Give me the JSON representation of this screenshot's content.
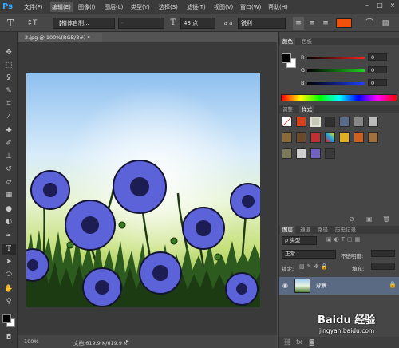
{
  "app": {
    "logo": "Ps"
  },
  "menu": {
    "items": [
      "文件(F)",
      "编辑(E)",
      "图像(I)",
      "图层(L)",
      "类型(Y)",
      "选择(S)",
      "滤镜(T)",
      "视图(V)",
      "窗口(W)",
      "帮助(H)"
    ],
    "window_buttons": [
      "–",
      "□",
      "×"
    ]
  },
  "options": {
    "font_family": "【楷体自制...",
    "font_style": "-",
    "font_size": "48 点",
    "aa_label": "a a",
    "aa_value": "锐利",
    "color": "#f0520c"
  },
  "document": {
    "tab_title": "2.jpg @ 100%(RGB/8#) *",
    "zoom": "100%",
    "status_text": "文档:619.9 K/619.9 K"
  },
  "color_panel": {
    "tabs": [
      "颜色",
      "色板"
    ],
    "channels": [
      {
        "label": "R",
        "value": "0",
        "track": "#ff3030"
      },
      {
        "label": "G",
        "value": "0",
        "track": "#30c030"
      },
      {
        "label": "B",
        "value": "0",
        "track": "#3050ff"
      }
    ],
    "foreground": "#000000",
    "background": "#ffffff"
  },
  "styles_panel": {
    "tabs": [
      "调整",
      "样式"
    ]
  },
  "layers_panel": {
    "tabs": [
      "图层",
      "通道",
      "路径",
      "历史记录"
    ],
    "filter_label": "ρ 类型",
    "blend_mode": "正常",
    "opacity_label": "不透明度:",
    "lock_label": "锁定:",
    "fill_label": "填充:",
    "layer_name": "背景"
  },
  "watermark": {
    "brand": "Baidu 经验",
    "url": "jingyan.baidu.com"
  }
}
